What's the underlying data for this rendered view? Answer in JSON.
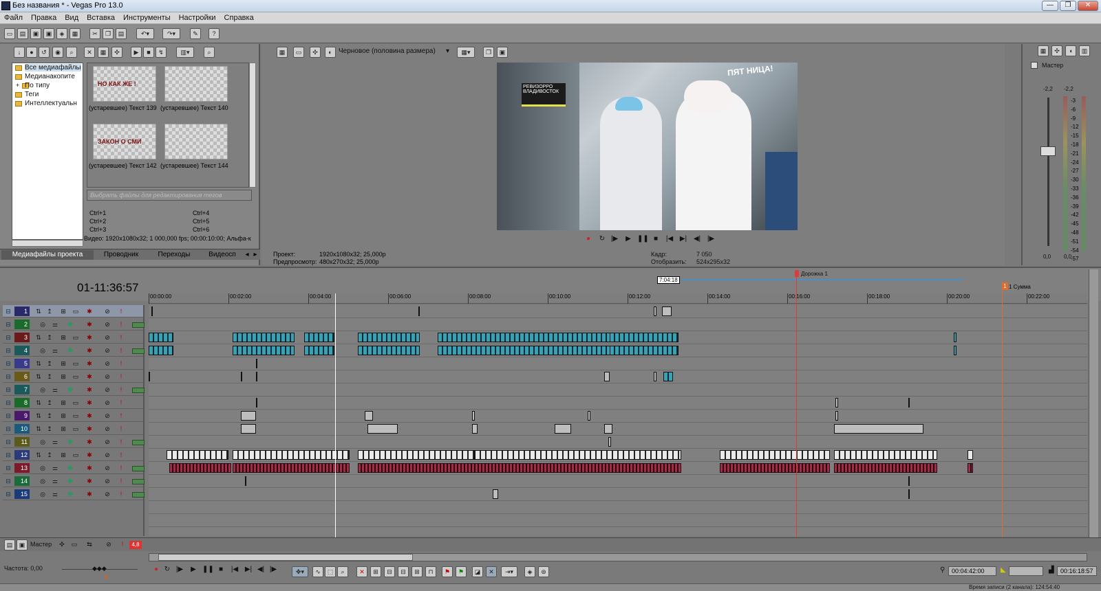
{
  "window": {
    "title": "Без названия * - Vegas Pro 13.0",
    "buttons": [
      "—",
      "❐",
      "✕"
    ]
  },
  "menu": [
    "Файл",
    "Правка",
    "Вид",
    "Вставка",
    "Инструменты",
    "Настройки",
    "Справка"
  ],
  "media": {
    "tree": [
      "Все медиафайлы",
      "Медианакопите",
      "По типу",
      "Теги",
      "Интеллектуальн"
    ],
    "tree_expand": "+",
    "thumbs": [
      {
        "label": "(устаревшее) Текст 139",
        "caption": "НО КАК ЖЕ !"
      },
      {
        "label": "(устаревшее) Текст 140",
        "caption": ""
      },
      {
        "label": "(устаревшее) Текст 142",
        "caption": "ЗАКОН О СМИ"
      },
      {
        "label": "(устаревшее) Текст 144",
        "caption": ""
      }
    ],
    "tag_placeholder": "Выбрать файлы для редактирования тегов",
    "shortcuts": [
      "Ctrl+1",
      "Ctrl+4",
      "Ctrl+2",
      "Ctrl+5",
      "Ctrl+3",
      "Ctrl+6"
    ],
    "info": "Видео: 1920x1080x32; 1 000,000 fps; 00:00:10:00; Альфа-к",
    "tabs": [
      "Медиафайлы проекта",
      "Проводник",
      "Переходы",
      "Видеосп"
    ]
  },
  "preview": {
    "quality": "Черновое (половина размера)",
    "project_label": "Проект:",
    "project_value": "1920x1080x32; 25,000p",
    "preview_label": "Предпросмотр:",
    "preview_value": "480x270x32; 25,000p",
    "frame_label": "Кадр:",
    "frame_value": "7 050",
    "display_label": "Отобразить:",
    "display_value": "524x295x32",
    "overlay_badge": "РЕВИЗОРРО ВЛАДИВОСТОК",
    "overlay_logo": "ПЯТ НИЦА!"
  },
  "master": {
    "title": "Мастер",
    "peak_left": "-2,2",
    "peak_right": "-2,2",
    "scale": [
      "-3",
      "-6",
      "-9",
      "-12",
      "-15",
      "-18",
      "-21",
      "-24",
      "-27",
      "-30",
      "-33",
      "-36",
      "-39",
      "-42",
      "-45",
      "-48",
      "-51",
      "-54",
      "-57"
    ],
    "bottom_left": "0,0",
    "bottom_right": "0,0"
  },
  "timeline": {
    "timecode": "01-11:36:57",
    "ruler": [
      "00:00:00",
      "00:02:00",
      "00:04:00",
      "00:06:00",
      "00:08:00",
      "00:10:00",
      "00:12:00",
      "00:14:00",
      "00:16:00",
      "00:18:00",
      "00:20:00",
      "00:22:00"
    ],
    "region_label": "Дорожка 1",
    "loop_length": "7:04:18",
    "end_label": "1 Сумма",
    "tracks": [
      "1",
      "2",
      "3",
      "4",
      "5",
      "6",
      "7",
      "8",
      "9",
      "10",
      "11",
      "12",
      "13",
      "14",
      "15"
    ],
    "master_label": "Мастер",
    "master_level": "4,8",
    "rate_label": "Частота: 0,00",
    "cursor_time": "00:04:42:00",
    "end_time": "00:16:18:57",
    "status": "Время записи (2 канала): 124:54:40"
  },
  "colors": {
    "accent": "#3aa0b4",
    "audio": "#a52b47",
    "cursor": "#ffffff",
    "play": "#e03b3b"
  }
}
